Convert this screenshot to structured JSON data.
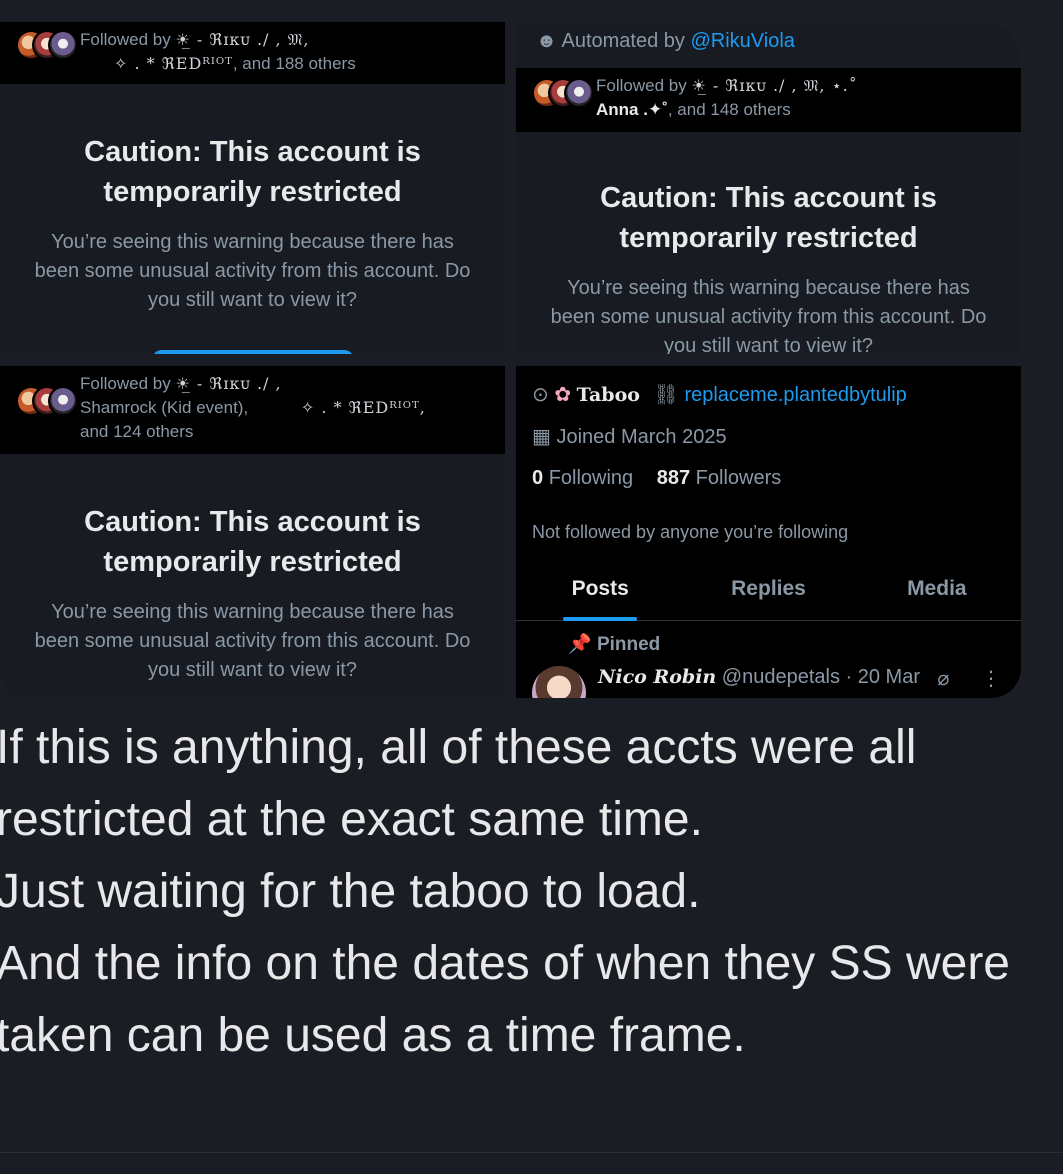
{
  "shot1": {
    "followed_line1_prefix": "Followed by",
    "followed_line1_names": "☀̲ - ℜɪᴋᴜ ./    , 𝔐,",
    "followed_line2_names": "✧ . * ℜEDᴿᴵᴼᵀ",
    "followed_line2_suffix": ", and 188 others",
    "title_line1": "Caution: This account is",
    "title_line2": "temporarily restricted",
    "body": "You’re seeing this warning because there has been some unusual activity from this account. Do you still want to view it?"
  },
  "shot2": {
    "automated_prefix": "Automated by",
    "automated_handle": "@RikuViola",
    "followed_line1_prefix": "Followed by",
    "followed_line1_names": "☀̲ - ℜɪᴋᴜ ./    , 𝔐, ⋆.˚",
    "followed_line2_name": "Anna .✦˚",
    "followed_line2_suffix": ", and 148 others",
    "title_line1": "Caution: This account is",
    "title_line2": "temporarily restricted",
    "body": "You’re seeing this warning because there has been some unusual activity from this account. Do you still want to view it?"
  },
  "shot3": {
    "followed_line1_prefix": "Followed by",
    "followed_line1_names": "☀̲ - ℜɪᴋᴜ ./    ,",
    "followed_line2": "Shamrock (Kid event),",
    "followed_line2_names": "✧ . * ℜEDᴿᴵᴼᵀ,",
    "followed_line3": "and 124 others",
    "title_line1": "Caution: This account is",
    "title_line2": "temporarily restricted",
    "body": "You’re seeing this warning because there has been some unusual activity from this account. Do you still want to view it?"
  },
  "shot4": {
    "location": "Taboo",
    "url": "replaceme.plantedbytulip",
    "joined": "Joined March 2025",
    "following_count": "0",
    "following_label": "Following",
    "followers_count": "887",
    "followers_label": "Followers",
    "not_followed": "Not followed by anyone you’re following",
    "tabs": [
      "Posts",
      "Replies",
      "Media"
    ],
    "pinned": "Pinned",
    "post_author": "Nico Robin",
    "post_handle": "@nudepetals · 20 Mar"
  },
  "caption": [
    "If this is anything, all of these accts were all",
    "restricted at the exact same time.",
    "Just waiting for the taboo to load.",
    "And the info on the dates of when they SS were",
    "taken can be used as a time frame."
  ],
  "colors": {
    "accent": "#1d9bf0",
    "muted": "#8b98a5",
    "bg": "#1a1d24"
  }
}
